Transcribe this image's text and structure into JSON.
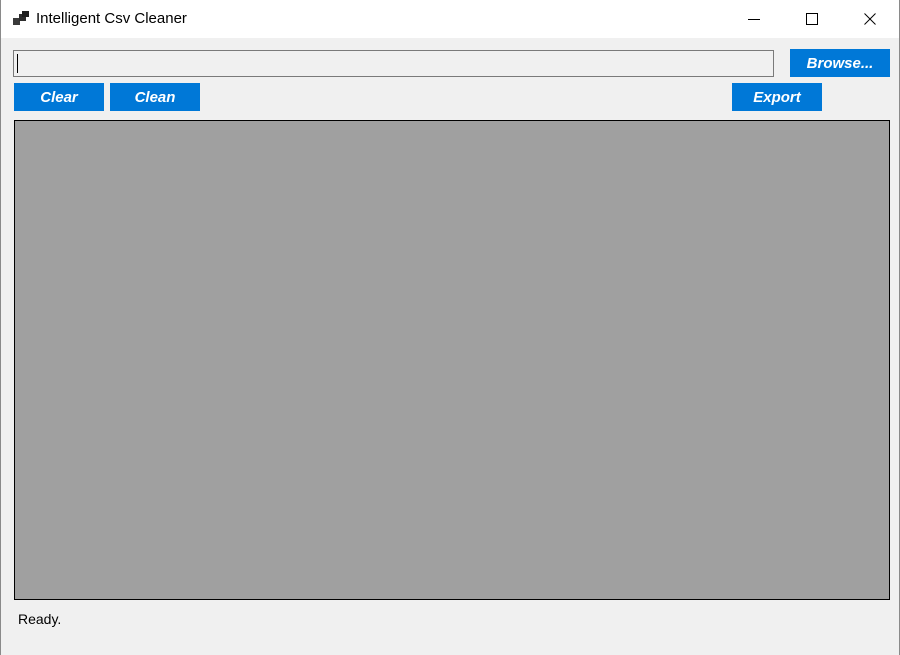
{
  "window": {
    "title": "Intelligent Csv Cleaner",
    "icon": "app-window-icon",
    "controls": {
      "minimize_icon": "minimize-icon",
      "maximize_icon": "maximize-icon",
      "close_icon": "close-icon"
    }
  },
  "toolbar": {
    "file_path_value": "",
    "browse_label": "Browse...",
    "clear_label": "Clear",
    "clean_label": "Clean",
    "export_label": "Export"
  },
  "grid": {
    "rows": [],
    "columns": []
  },
  "status": {
    "text": "Ready."
  },
  "colors": {
    "accent": "#0078d7",
    "button_text": "#ffffff",
    "background": "#f0f0f0",
    "grid_background": "#a0a0a0",
    "titlebar": "#ffffff"
  }
}
